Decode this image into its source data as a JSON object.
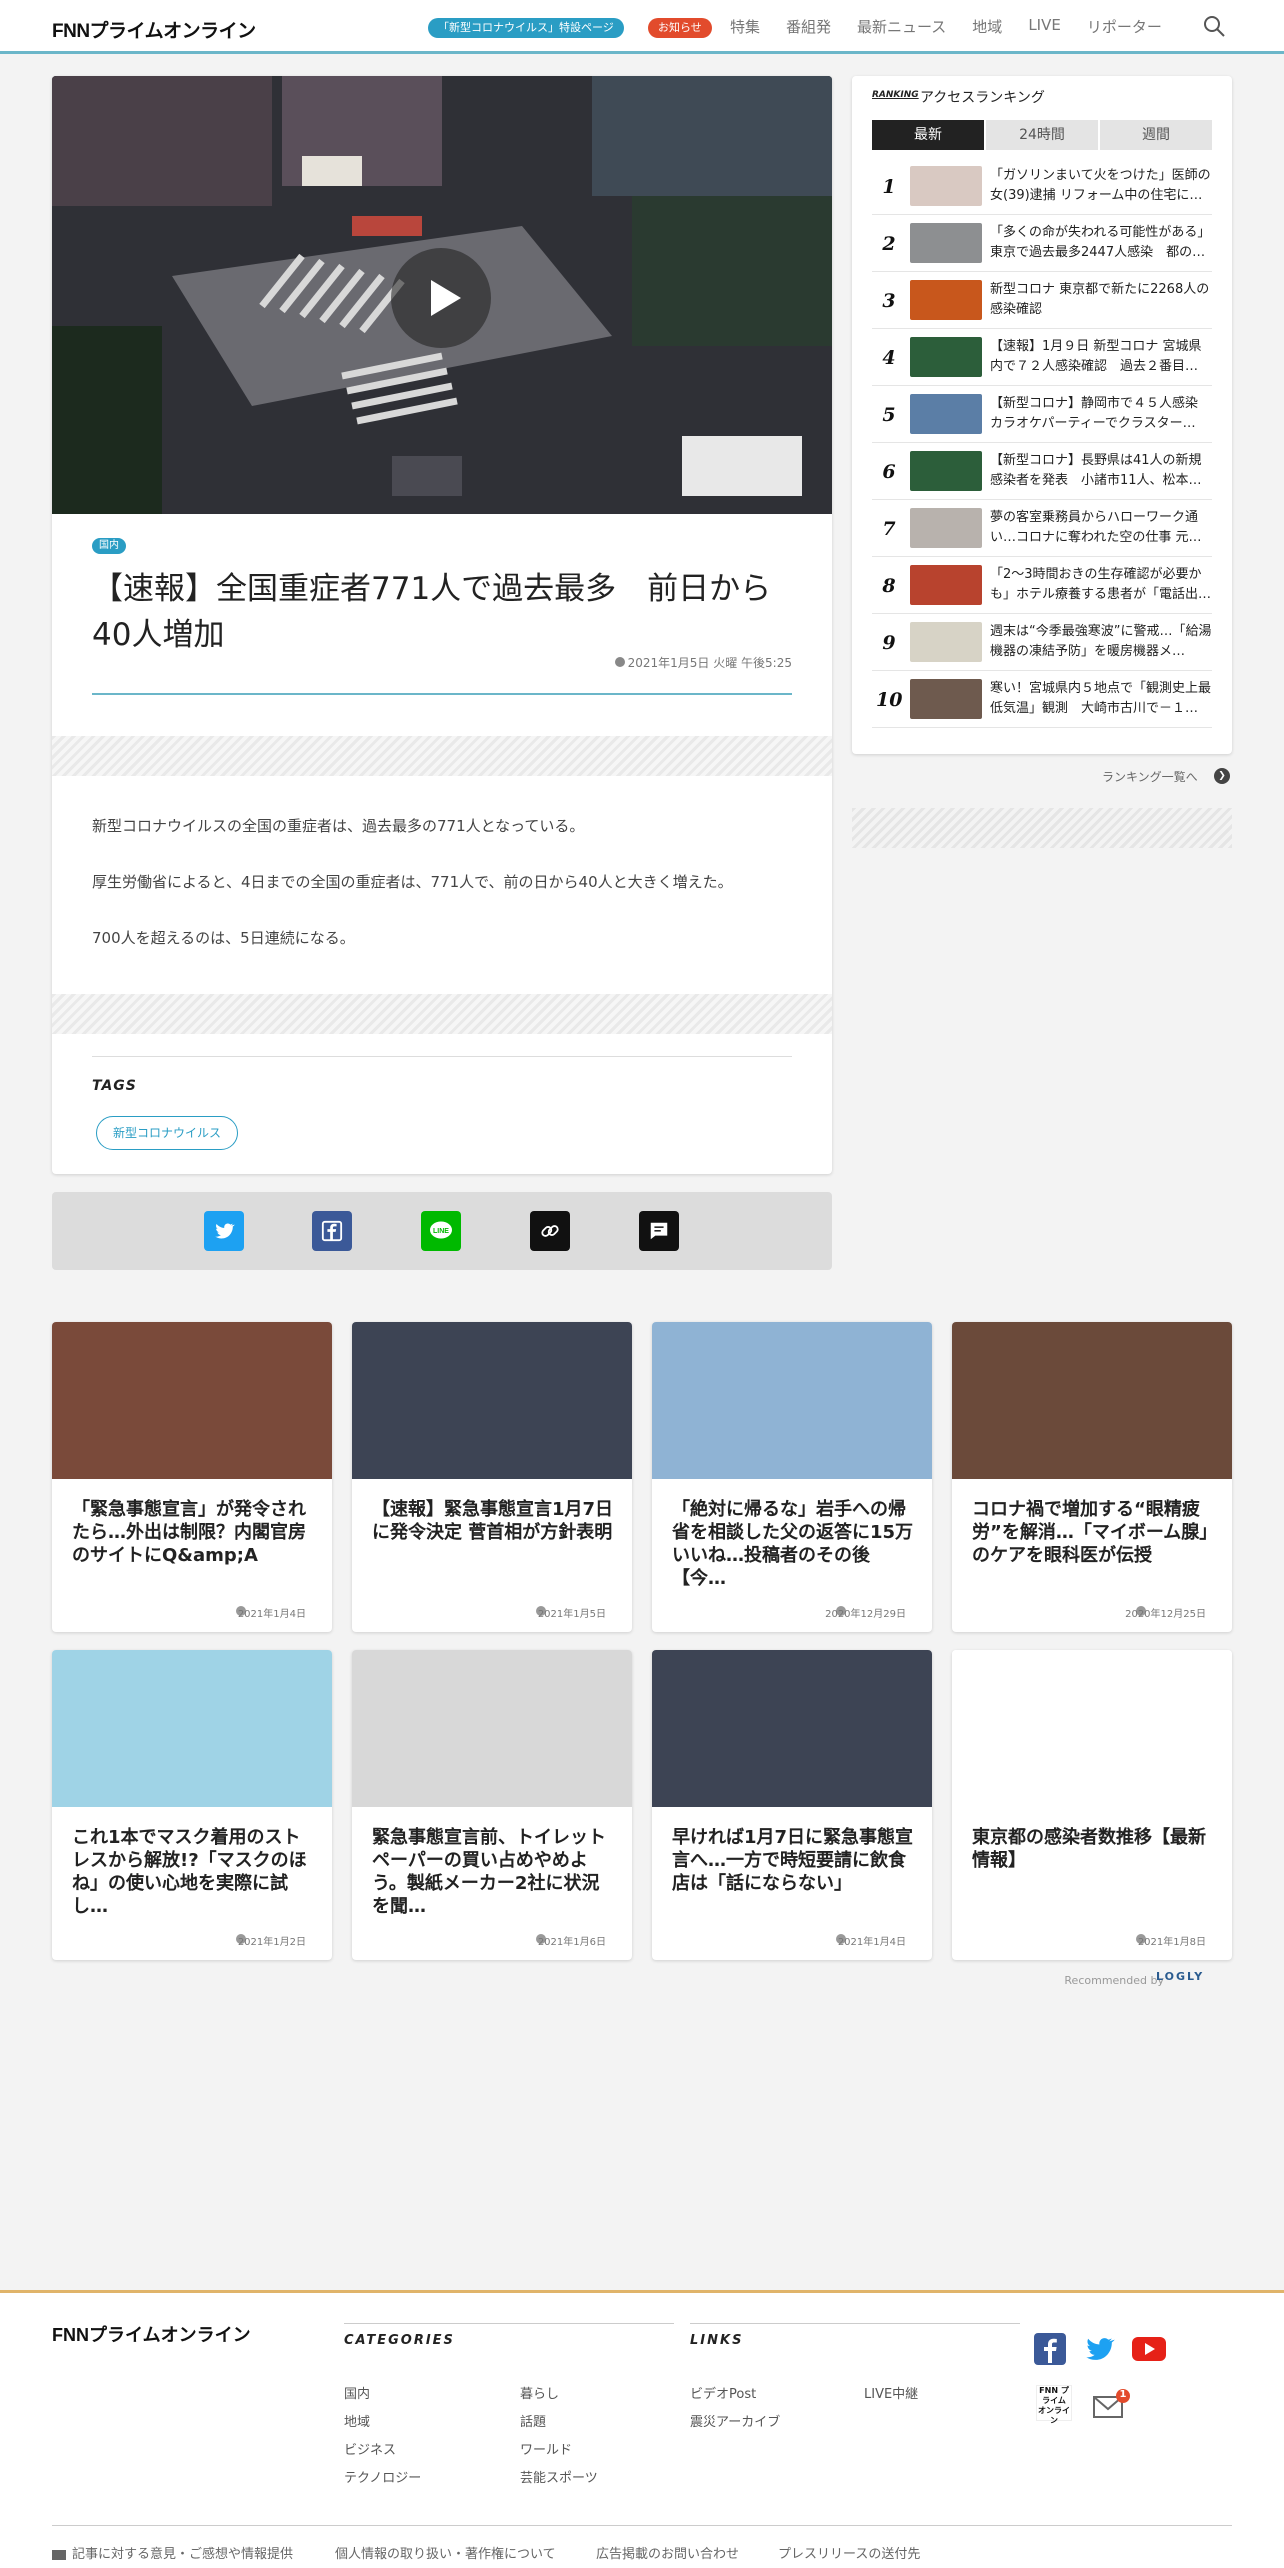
{
  "header": {
    "logo": "FNNプライムオンライン",
    "corona_pill": "「新型コロナウイルス」特設ページ",
    "notice_pill": "お知らせ",
    "nav": [
      "特集",
      "番組発",
      "最新ニュース",
      "地域",
      "LIVE",
      "リポーター"
    ]
  },
  "article": {
    "category": "国内",
    "title": "【速報】全国重症者771人で過去最多　前日から40人増加",
    "date": "2021年1月5日 火曜 午後5:25",
    "paragraphs": [
      "新型コロナウイルスの全国の重症者は、過去最多の771人となっている。",
      "厚生労働省によると、4日までの全国の重症者は、771人で、前の日から40人と大きく増えた。",
      "700人を超えるのは、5日連続になる。"
    ],
    "tags_heading": "TAGS",
    "tag": "新型コロナウイルス"
  },
  "share": [
    "twitter-icon",
    "facebook-icon",
    "line-icon",
    "link-icon",
    "comment-icon"
  ],
  "ranking": {
    "label": "RANKING",
    "title": "アクセスランキング",
    "tabs": [
      "最新",
      "24時間",
      "週間"
    ],
    "items": [
      {
        "rank": "1",
        "text": "「ガソリンまいて火をつけた」医師の女(39)逮捕 リフォーム中の住宅に…",
        "thumb": "#d9c9c2"
      },
      {
        "rank": "2",
        "text": "「多くの命が失われる可能性がある」東京で過去最多2447人感染　都の…",
        "thumb": "#8d8f91"
      },
      {
        "rank": "3",
        "text": "新型コロナ 東京都で新たに2268人の感染確認",
        "thumb": "#c8571c"
      },
      {
        "rank": "4",
        "text": "【速報】1月９日 新型コロナ 宮城県内で７２人感染確認　過去２番目…",
        "thumb": "#2c5e3a"
      },
      {
        "rank": "5",
        "text": "【新型コロナ】静岡市で４５人感染 カラオケパーティーでクラスター…",
        "thumb": "#5b7ea6"
      },
      {
        "rank": "6",
        "text": "【新型コロナ】長野県は41人の新規感染者を発表　小諸市11人、松本…",
        "thumb": "#2c5e3a"
      },
      {
        "rank": "7",
        "text": "夢の客室乗務員からハローワーク通い…コロナに奪われた空の仕事 元…",
        "thumb": "#b8b2ad"
      },
      {
        "rank": "8",
        "text": "「2～3時間おきの生存確認が必要かも」ホテル療養する患者が「電話出…",
        "thumb": "#b8432e"
      },
      {
        "rank": "9",
        "text": "週末は“今季最強寒波”に警戒…「給湯機器の凍結予防」を暖房機器メ…",
        "thumb": "#d7d3c6"
      },
      {
        "rank": "10",
        "text": "寒い！宮城県内５地点で「観測史上最低気温」観測　大崎市古川で－１…",
        "thumb": "#6e5a4e"
      }
    ],
    "more": "ランキング一覧へ"
  },
  "recommendations": [
    {
      "title": "「緊急事態宣言」が発令されたら…外出は制限？内閣官房のサイトにQ&amp;A",
      "date": "2021年1月4日",
      "color": "#7a4a3a"
    },
    {
      "title": "【速報】緊急事態宣言1月7日に発令決定 菅首相が方針表明",
      "date": "2021年1月5日",
      "color": "#3d4454"
    },
    {
      "title": "「絶対に帰るな」岩手への帰省を相談した父の返答に15万いいね…投稿者のその後【今…",
      "date": "2020年12月29日",
      "color": "#8fb3d4"
    },
    {
      "title": "コロナ禍で増加する“眼精疲労”を解消…「マイボーム腺」のケアを眼科医が伝授",
      "date": "2020年12月25日",
      "color": "#6b4a3a"
    },
    {
      "title": "これ1本でマスク着用のストレスから解放!?「マスクのほね」の使い心地を実際に試し…",
      "date": "2021年1月2日",
      "color": "#9fd3e6"
    },
    {
      "title": "緊急事態宣言前、トイレットペーパーの買い占めやめよう。製紙メーカー2社に状況を聞…",
      "date": "2021年1月6日",
      "color": "#d8d8d8"
    },
    {
      "title": "早ければ1月7日に緊急事態宣言へ…一方で時短要請に飲食店は「話にならない」",
      "date": "2021年1月4日",
      "color": "#3d4454"
    },
    {
      "title": "東京都の感染者数推移【最新情報】",
      "date": "2021年1月8日",
      "color": "#ffffff"
    }
  ],
  "recommended_by": "Recommended by",
  "logly": "LOGLY",
  "footer": {
    "logo": "FNNプライムオンライン",
    "categories_heading": "CATEGORIES",
    "categories": [
      "国内",
      "暮らし",
      "地域",
      "話題",
      "ビジネス",
      "ワールド",
      "テクノロジー",
      "芸能スポーツ"
    ],
    "links_heading": "LINKS",
    "links": [
      "ビデオPost",
      "LIVE中継",
      "震災アーカイブ"
    ],
    "bottom": [
      "記事に対する意見・ご感想や情報提供",
      "個人情報の取り扱い・著作権について",
      "広告掲載のお問い合わせ",
      "プレスリリースの送付先"
    ],
    "mail_badge": "1",
    "small_logo": "FNN プライム オンライン"
  }
}
